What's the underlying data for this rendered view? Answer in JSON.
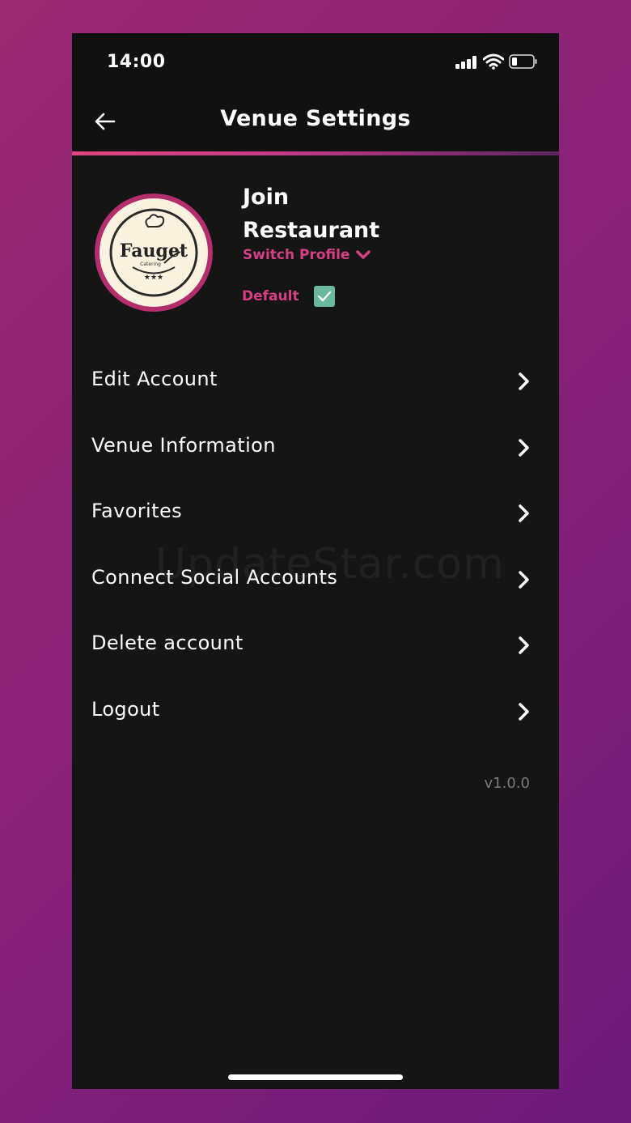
{
  "status_bar": {
    "time": "14:00",
    "icons": [
      "cellular-signal-icon",
      "wifi-icon",
      "battery-icon"
    ]
  },
  "app_bar": {
    "back_icon": "arrow-left-icon",
    "title": "Venue Settings"
  },
  "profile": {
    "name_line1": "Join",
    "name_line2": "Restaurant",
    "switch_profile_label": "Switch Profile",
    "switch_icon": "chevron-down-icon",
    "default_label": "Default",
    "default_checked": true,
    "logo": {
      "brand": "Fauget",
      "tagline": "Catering"
    }
  },
  "menu": {
    "items": [
      {
        "label": "Edit Account"
      },
      {
        "label": "Venue Information"
      },
      {
        "label": "Favorites"
      },
      {
        "label": "Connect Social Accounts"
      },
      {
        "label": "Delete account"
      },
      {
        "label": "Logout"
      }
    ],
    "chevron_icon": "chevron-right-icon"
  },
  "version": "v1.0.0",
  "watermark": "UpdateStar.com",
  "colors": {
    "background": "#151515",
    "accent": "#d53f86",
    "avatar_ring": "#b32d6f",
    "checkbox": "#6ab8a0",
    "version_text": "#7a7a7a"
  }
}
